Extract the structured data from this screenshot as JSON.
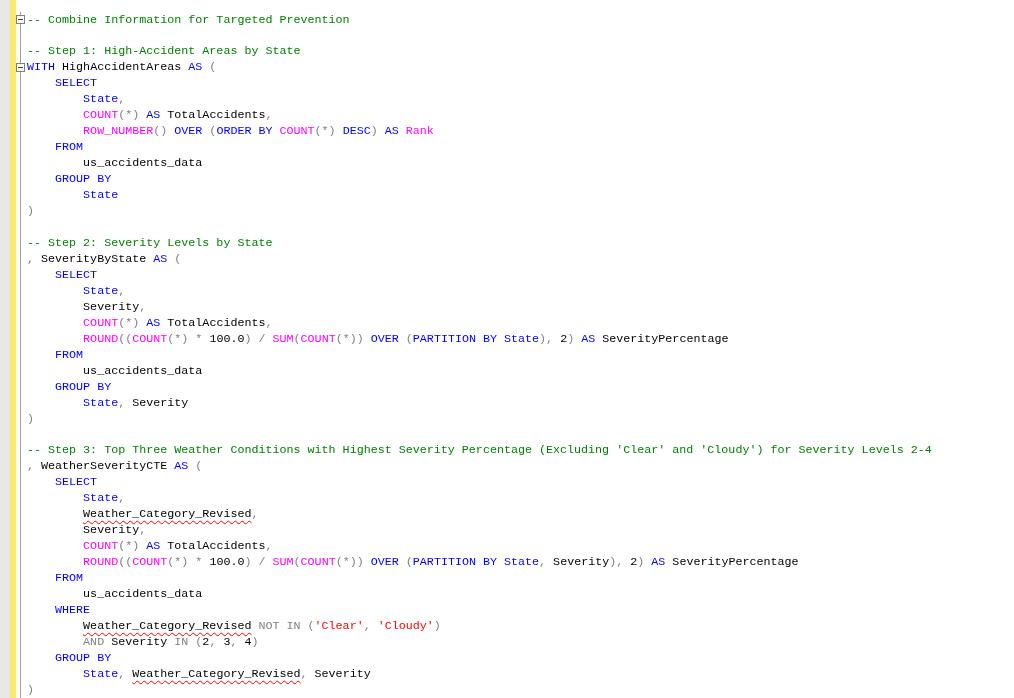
{
  "editor": {
    "lines": [
      {
        "kind": "code",
        "fold": {
          "expanded": true
        },
        "tokens": [
          {
            "kind": "comment",
            "text": "-- Combine Information for Targeted Prevention"
          }
        ]
      },
      {
        "kind": "blank"
      },
      {
        "kind": "code",
        "tokens": [
          {
            "kind": "comment",
            "text": "-- Step 1: High-Accident Areas by State"
          }
        ]
      },
      {
        "kind": "code",
        "fold": {
          "expanded": true
        },
        "tokens": [
          {
            "kind": "keyword",
            "text": "WITH"
          },
          {
            "kind": "plain",
            "text": " HighAccidentAreas "
          },
          {
            "kind": "keyword",
            "text": "AS"
          },
          {
            "kind": "operator",
            "text": " ("
          }
        ]
      },
      {
        "kind": "code",
        "tokens": [
          {
            "kind": "keyword",
            "text": "    SELECT"
          }
        ]
      },
      {
        "kind": "code",
        "tokens": [
          {
            "kind": "keyword",
            "text": "        State"
          },
          {
            "kind": "operator",
            "text": ","
          }
        ]
      },
      {
        "kind": "code",
        "tokens": [
          {
            "kind": "function",
            "text": "        COUNT"
          },
          {
            "kind": "operator",
            "text": "(*)"
          },
          {
            "kind": "keyword",
            "text": " AS"
          },
          {
            "kind": "plain",
            "text": " TotalAccidents"
          },
          {
            "kind": "operator",
            "text": ","
          }
        ]
      },
      {
        "kind": "code",
        "tokens": [
          {
            "kind": "function",
            "text": "        ROW_NUMBER"
          },
          {
            "kind": "operator",
            "text": "()"
          },
          {
            "kind": "keyword",
            "text": " OVER"
          },
          {
            "kind": "operator",
            "text": " ("
          },
          {
            "kind": "keyword",
            "text": "ORDER BY"
          },
          {
            "kind": "function",
            "text": " COUNT"
          },
          {
            "kind": "operator",
            "text": "(*)"
          },
          {
            "kind": "keyword",
            "text": " DESC"
          },
          {
            "kind": "operator",
            "text": ")"
          },
          {
            "kind": "keyword",
            "text": " AS"
          },
          {
            "kind": "function",
            "text": " Rank"
          }
        ]
      },
      {
        "kind": "code",
        "tokens": [
          {
            "kind": "keyword",
            "text": "    FROM"
          }
        ]
      },
      {
        "kind": "code",
        "tokens": [
          {
            "kind": "plain",
            "text": "        us_accidents_data"
          }
        ]
      },
      {
        "kind": "code",
        "tokens": [
          {
            "kind": "keyword",
            "text": "    GROUP BY"
          }
        ]
      },
      {
        "kind": "code",
        "tokens": [
          {
            "kind": "keyword",
            "text": "        State"
          }
        ]
      },
      {
        "kind": "code",
        "tokens": [
          {
            "kind": "operator",
            "text": ")"
          }
        ]
      },
      {
        "kind": "blank"
      },
      {
        "kind": "code",
        "tokens": [
          {
            "kind": "comment",
            "text": "-- Step 2: Severity Levels by State"
          }
        ]
      },
      {
        "kind": "code",
        "tokens": [
          {
            "kind": "operator",
            "text": ","
          },
          {
            "kind": "plain",
            "text": " SeverityByState "
          },
          {
            "kind": "keyword",
            "text": "AS"
          },
          {
            "kind": "operator",
            "text": " ("
          }
        ]
      },
      {
        "kind": "code",
        "tokens": [
          {
            "kind": "keyword",
            "text": "    SELECT"
          }
        ]
      },
      {
        "kind": "code",
        "tokens": [
          {
            "kind": "keyword",
            "text": "        State"
          },
          {
            "kind": "operator",
            "text": ","
          }
        ]
      },
      {
        "kind": "code",
        "tokens": [
          {
            "kind": "plain",
            "text": "        Severity"
          },
          {
            "kind": "operator",
            "text": ","
          }
        ]
      },
      {
        "kind": "code",
        "tokens": [
          {
            "kind": "function",
            "text": "        COUNT"
          },
          {
            "kind": "operator",
            "text": "(*)"
          },
          {
            "kind": "keyword",
            "text": " AS"
          },
          {
            "kind": "plain",
            "text": " TotalAccidents"
          },
          {
            "kind": "operator",
            "text": ","
          }
        ]
      },
      {
        "kind": "code",
        "tokens": [
          {
            "kind": "function",
            "text": "        ROUND"
          },
          {
            "kind": "operator",
            "text": "(("
          },
          {
            "kind": "function",
            "text": "COUNT"
          },
          {
            "kind": "operator",
            "text": "(*) *"
          },
          {
            "kind": "plain",
            "text": " 100.0"
          },
          {
            "kind": "operator",
            "text": ") /"
          },
          {
            "kind": "function",
            "text": " SUM"
          },
          {
            "kind": "operator",
            "text": "("
          },
          {
            "kind": "function",
            "text": "COUNT"
          },
          {
            "kind": "operator",
            "text": "(*))"
          },
          {
            "kind": "keyword",
            "text": " OVER"
          },
          {
            "kind": "operator",
            "text": " ("
          },
          {
            "kind": "keyword",
            "text": "PARTITION BY State"
          },
          {
            "kind": "operator",
            "text": "),"
          },
          {
            "kind": "plain",
            "text": " 2"
          },
          {
            "kind": "operator",
            "text": ")"
          },
          {
            "kind": "keyword",
            "text": " AS"
          },
          {
            "kind": "plain",
            "text": " SeverityPercentage"
          }
        ]
      },
      {
        "kind": "code",
        "tokens": [
          {
            "kind": "keyword",
            "text": "    FROM"
          }
        ]
      },
      {
        "kind": "code",
        "tokens": [
          {
            "kind": "plain",
            "text": "        us_accidents_data"
          }
        ]
      },
      {
        "kind": "code",
        "tokens": [
          {
            "kind": "keyword",
            "text": "    GROUP BY"
          }
        ]
      },
      {
        "kind": "code",
        "tokens": [
          {
            "kind": "keyword",
            "text": "        State"
          },
          {
            "kind": "operator",
            "text": ","
          },
          {
            "kind": "plain",
            "text": " Severity"
          }
        ]
      },
      {
        "kind": "code",
        "tokens": [
          {
            "kind": "operator",
            "text": ")"
          }
        ]
      },
      {
        "kind": "blank"
      },
      {
        "kind": "code",
        "tokens": [
          {
            "kind": "comment",
            "text": "-- Step 3: Top Three Weather Conditions with Highest Severity Percentage (Excluding 'Clear' and 'Cloudy') for Severity Levels 2-4"
          }
        ]
      },
      {
        "kind": "code",
        "tokens": [
          {
            "kind": "operator",
            "text": ","
          },
          {
            "kind": "plain",
            "text": " WeatherSeverityCTE "
          },
          {
            "kind": "keyword",
            "text": "AS"
          },
          {
            "kind": "operator",
            "text": " ("
          }
        ]
      },
      {
        "kind": "code",
        "tokens": [
          {
            "kind": "keyword",
            "text": "    SELECT"
          }
        ]
      },
      {
        "kind": "code",
        "tokens": [
          {
            "kind": "keyword",
            "text": "        State"
          },
          {
            "kind": "operator",
            "text": ","
          }
        ]
      },
      {
        "kind": "code",
        "tokens": [
          {
            "kind": "flagged",
            "text": "        Weather_Category_Revised"
          },
          {
            "kind": "operator",
            "text": ","
          }
        ]
      },
      {
        "kind": "code",
        "tokens": [
          {
            "kind": "plain",
            "text": "        Severity"
          },
          {
            "kind": "operator",
            "text": ","
          }
        ]
      },
      {
        "kind": "code",
        "tokens": [
          {
            "kind": "function",
            "text": "        COUNT"
          },
          {
            "kind": "operator",
            "text": "(*)"
          },
          {
            "kind": "keyword",
            "text": " AS"
          },
          {
            "kind": "plain",
            "text": " TotalAccidents"
          },
          {
            "kind": "operator",
            "text": ","
          }
        ]
      },
      {
        "kind": "code",
        "tokens": [
          {
            "kind": "function",
            "text": "        ROUND"
          },
          {
            "kind": "operator",
            "text": "(("
          },
          {
            "kind": "function",
            "text": "COUNT"
          },
          {
            "kind": "operator",
            "text": "(*) *"
          },
          {
            "kind": "plain",
            "text": " 100.0"
          },
          {
            "kind": "operator",
            "text": ") /"
          },
          {
            "kind": "function",
            "text": " SUM"
          },
          {
            "kind": "operator",
            "text": "("
          },
          {
            "kind": "function",
            "text": "COUNT"
          },
          {
            "kind": "operator",
            "text": "(*))"
          },
          {
            "kind": "keyword",
            "text": " OVER"
          },
          {
            "kind": "operator",
            "text": " ("
          },
          {
            "kind": "keyword",
            "text": "PARTITION BY State"
          },
          {
            "kind": "operator",
            "text": ","
          },
          {
            "kind": "plain",
            "text": " Severity"
          },
          {
            "kind": "operator",
            "text": "),"
          },
          {
            "kind": "plain",
            "text": " 2"
          },
          {
            "kind": "operator",
            "text": ")"
          },
          {
            "kind": "keyword",
            "text": " AS"
          },
          {
            "kind": "plain",
            "text": " SeverityPercentage"
          }
        ]
      },
      {
        "kind": "code",
        "tokens": [
          {
            "kind": "keyword",
            "text": "    FROM"
          }
        ]
      },
      {
        "kind": "code",
        "tokens": [
          {
            "kind": "plain",
            "text": "        us_accidents_data"
          }
        ]
      },
      {
        "kind": "code",
        "tokens": [
          {
            "kind": "keyword",
            "text": "    WHERE"
          }
        ]
      },
      {
        "kind": "code",
        "tokens": [
          {
            "kind": "flagged",
            "text": "        Weather_Category_Revised"
          },
          {
            "kind": "operator",
            "text": " NOT IN ("
          },
          {
            "kind": "string",
            "text": "'Clear'"
          },
          {
            "kind": "operator",
            "text": ", "
          },
          {
            "kind": "string",
            "text": "'Cloudy'"
          },
          {
            "kind": "operator",
            "text": ")"
          }
        ]
      },
      {
        "kind": "code",
        "tokens": [
          {
            "kind": "operator",
            "text": "        AND"
          },
          {
            "kind": "plain",
            "text": " Severity"
          },
          {
            "kind": "operator",
            "text": " IN ("
          },
          {
            "kind": "plain",
            "text": "2"
          },
          {
            "kind": "operator",
            "text": ","
          },
          {
            "kind": "plain",
            "text": " 3"
          },
          {
            "kind": "operator",
            "text": ","
          },
          {
            "kind": "plain",
            "text": " 4"
          },
          {
            "kind": "operator",
            "text": ")"
          }
        ]
      },
      {
        "kind": "code",
        "tokens": [
          {
            "kind": "keyword",
            "text": "    GROUP BY"
          }
        ]
      },
      {
        "kind": "code",
        "tokens": [
          {
            "kind": "keyword",
            "text": "        State"
          },
          {
            "kind": "operator",
            "text": ", "
          },
          {
            "kind": "flagged",
            "text": "Weather_Category_Revised"
          },
          {
            "kind": "operator",
            "text": ","
          },
          {
            "kind": "plain",
            "text": " Severity"
          }
        ]
      },
      {
        "kind": "code",
        "tokens": [
          {
            "kind": "operator",
            "text": ")"
          }
        ]
      }
    ]
  }
}
